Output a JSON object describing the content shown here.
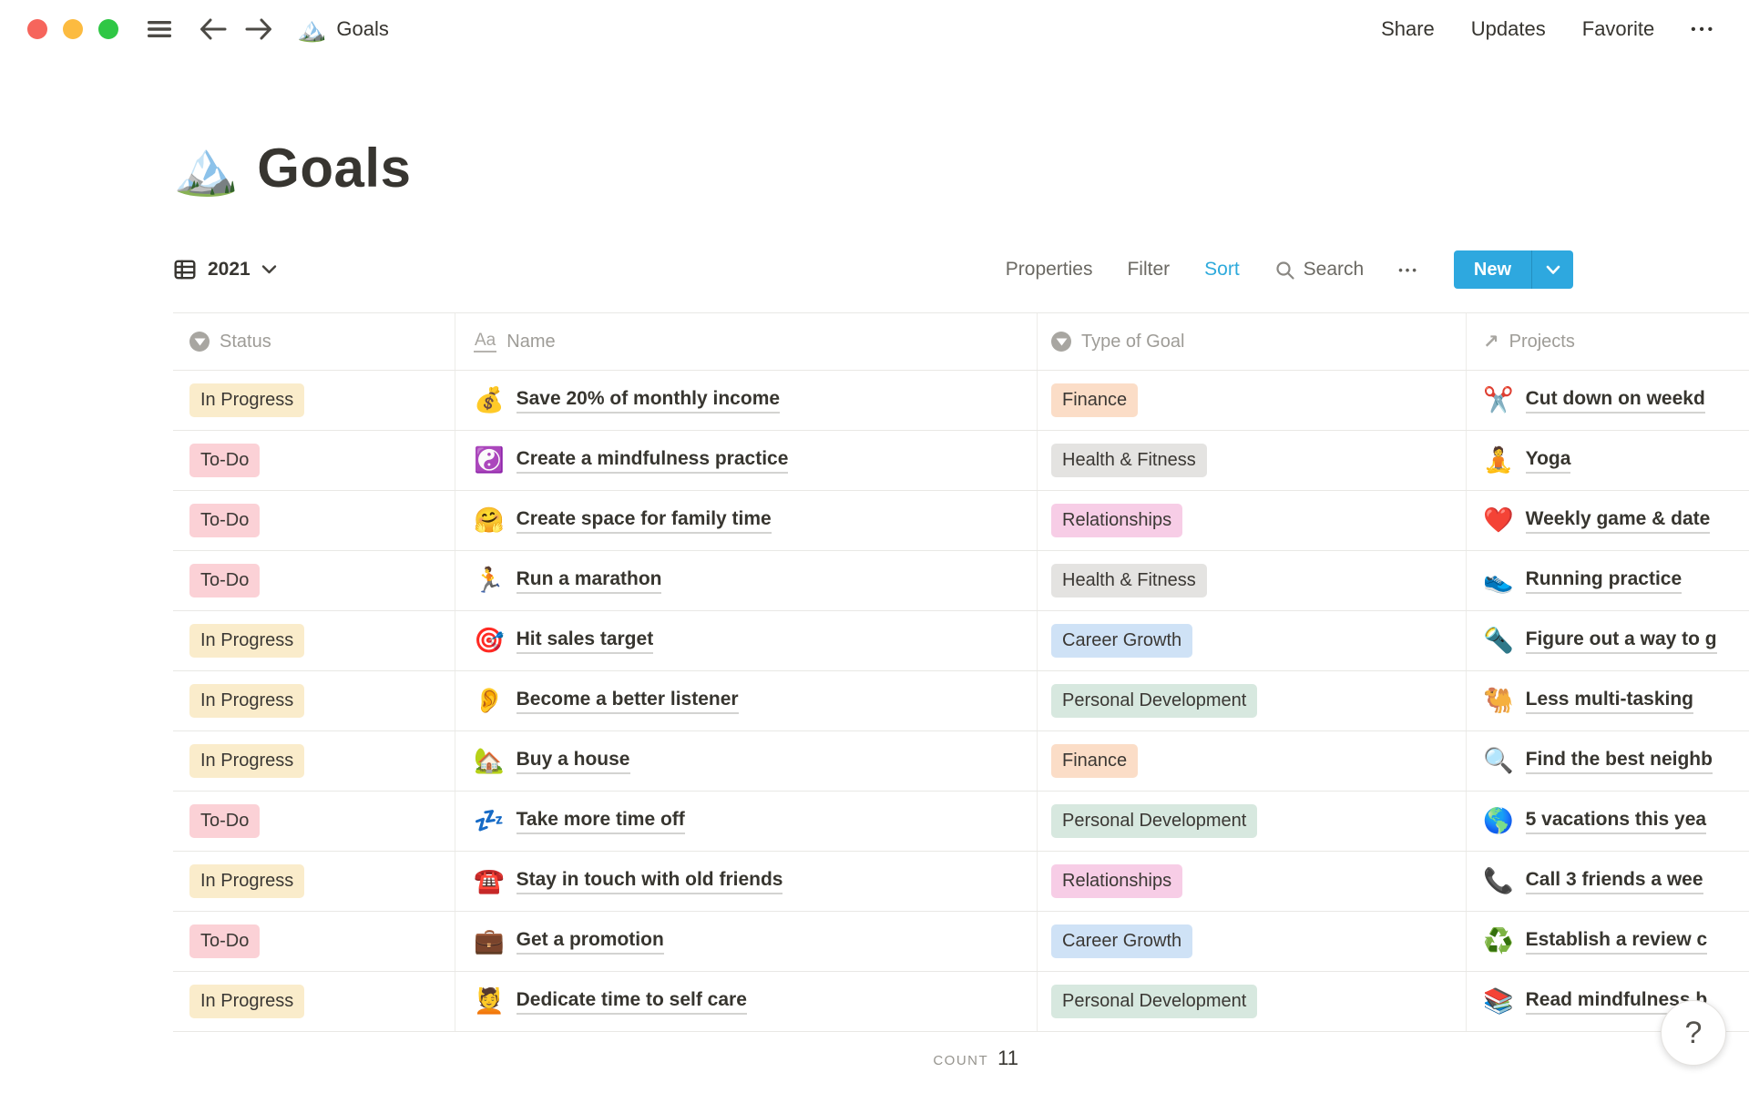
{
  "titlebar": {
    "doc_icon": "🏔️",
    "doc_title": "Goals",
    "share": "Share",
    "updates": "Updates",
    "favorite": "Favorite",
    "more": "•••"
  },
  "page": {
    "icon": "🏔️",
    "title": "Goals"
  },
  "toolbar": {
    "view_name": "2021",
    "properties": "Properties",
    "filter": "Filter",
    "sort": "Sort",
    "search": "Search",
    "more": "•••",
    "new_label": "New"
  },
  "table": {
    "columns": [
      {
        "label": "Status"
      },
      {
        "label": "Name"
      },
      {
        "label": "Type of Goal"
      },
      {
        "label": "Projects"
      }
    ],
    "rows": [
      {
        "status": {
          "label": "In Progress",
          "color": "#FAECCB"
        },
        "name": {
          "icon": "💰",
          "text": "Save 20% of monthly income"
        },
        "type": {
          "label": "Finance",
          "color": "#FBDDC7"
        },
        "project": {
          "icon": "✂️",
          "text": "Cut down on weekd"
        }
      },
      {
        "status": {
          "label": "To-Do",
          "color": "#FBD1D6"
        },
        "name": {
          "icon": "☯️",
          "text": "Create a mindfulness practice"
        },
        "type": {
          "label": "Health & Fitness",
          "color": "#E4E3E1"
        },
        "project": {
          "icon": "🧘",
          "text": "Yoga"
        }
      },
      {
        "status": {
          "label": "To-Do",
          "color": "#FBD1D6"
        },
        "name": {
          "icon": "🤗",
          "text": "Create space for family time"
        },
        "type": {
          "label": "Relationships",
          "color": "#F7CDE6"
        },
        "project": {
          "icon": "❤️",
          "text": "Weekly game & date"
        }
      },
      {
        "status": {
          "label": "To-Do",
          "color": "#FBD1D6"
        },
        "name": {
          "icon": "🏃",
          "text": "Run a marathon"
        },
        "type": {
          "label": "Health & Fitness",
          "color": "#E4E3E1"
        },
        "project": {
          "icon": "👟",
          "text": "Running practice"
        }
      },
      {
        "status": {
          "label": "In Progress",
          "color": "#FAECCB"
        },
        "name": {
          "icon": "🎯",
          "text": "Hit sales target"
        },
        "type": {
          "label": "Career Growth",
          "color": "#CFE2F6"
        },
        "project": {
          "icon": "🔦",
          "text": "Figure out a way to g"
        }
      },
      {
        "status": {
          "label": "In Progress",
          "color": "#FAECCB"
        },
        "name": {
          "icon": "👂",
          "text": "Become a better listener"
        },
        "type": {
          "label": "Personal Development",
          "color": "#D7E8DF"
        },
        "project": {
          "icon": "🐫",
          "text": "Less multi-tasking"
        }
      },
      {
        "status": {
          "label": "In Progress",
          "color": "#FAECCB"
        },
        "name": {
          "icon": "🏡",
          "text": "Buy a house"
        },
        "type": {
          "label": "Finance",
          "color": "#FBDDC7"
        },
        "project": {
          "icon": "🔍",
          "text": "Find the best neighb"
        }
      },
      {
        "status": {
          "label": "To-Do",
          "color": "#FBD1D6"
        },
        "name": {
          "icon": "💤",
          "text": "Take more time off"
        },
        "type": {
          "label": "Personal Development",
          "color": "#D7E8DF"
        },
        "project": {
          "icon": "🌎",
          "text": "5 vacations this yea"
        }
      },
      {
        "status": {
          "label": "In Progress",
          "color": "#FAECCB"
        },
        "name": {
          "icon": "☎️",
          "text": "Stay in touch with old friends"
        },
        "type": {
          "label": "Relationships",
          "color": "#F7CDE6"
        },
        "project": {
          "icon": "📞",
          "text": "Call 3 friends a wee"
        }
      },
      {
        "status": {
          "label": "To-Do",
          "color": "#FBD1D6"
        },
        "name": {
          "icon": "💼",
          "text": "Get a promotion"
        },
        "type": {
          "label": "Career Growth",
          "color": "#CFE2F6"
        },
        "project": {
          "icon": "♻️",
          "text": "Establish a review c"
        }
      },
      {
        "status": {
          "label": "In Progress",
          "color": "#FAECCB"
        },
        "name": {
          "icon": "💆",
          "text": "Dedicate time to self care"
        },
        "type": {
          "label": "Personal Development",
          "color": "#D7E8DF"
        },
        "project": {
          "icon": "📚",
          "text": "Read mindfulness b"
        }
      }
    ],
    "footer": {
      "count_label": "COUNT",
      "count_value": "11"
    }
  },
  "help": {
    "label": "?"
  },
  "colors": {
    "accent_blue": "#2EAADC",
    "new_button": "#2EA8DF"
  }
}
